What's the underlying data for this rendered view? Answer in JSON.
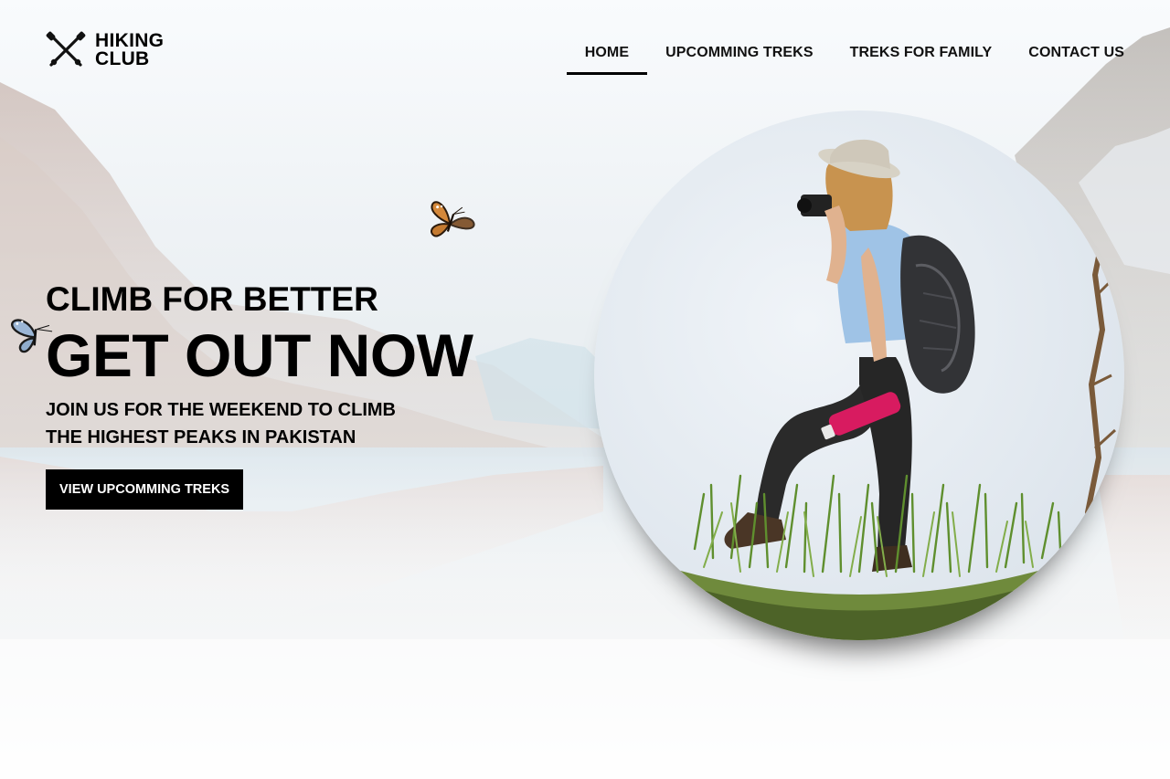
{
  "brand": {
    "line1": "HIKING",
    "line2": "CLUB",
    "icon": "crossed-trekking-poles-icon"
  },
  "nav": {
    "items": [
      {
        "label": "HOME",
        "active": true
      },
      {
        "label": "UPCOMMING TREKS",
        "active": false
      },
      {
        "label": "TREKS FOR FAMILY",
        "active": false
      },
      {
        "label": "CONTACT US",
        "active": false
      }
    ]
  },
  "hero": {
    "kicker": "CLIMB FOR BETTER",
    "headline": "GET OUT NOW",
    "subline1": "JOIN US FOR THE WEEKEND TO CLIMB",
    "subline2": "THE HIGHEST PEAKS IN PAKISTAN",
    "cta_label": "VIEW UPCOMMING TREKS"
  },
  "colors": {
    "text": "#000000",
    "button_bg": "#000000",
    "button_text": "#ffffff",
    "bottle": "#d81b60"
  }
}
